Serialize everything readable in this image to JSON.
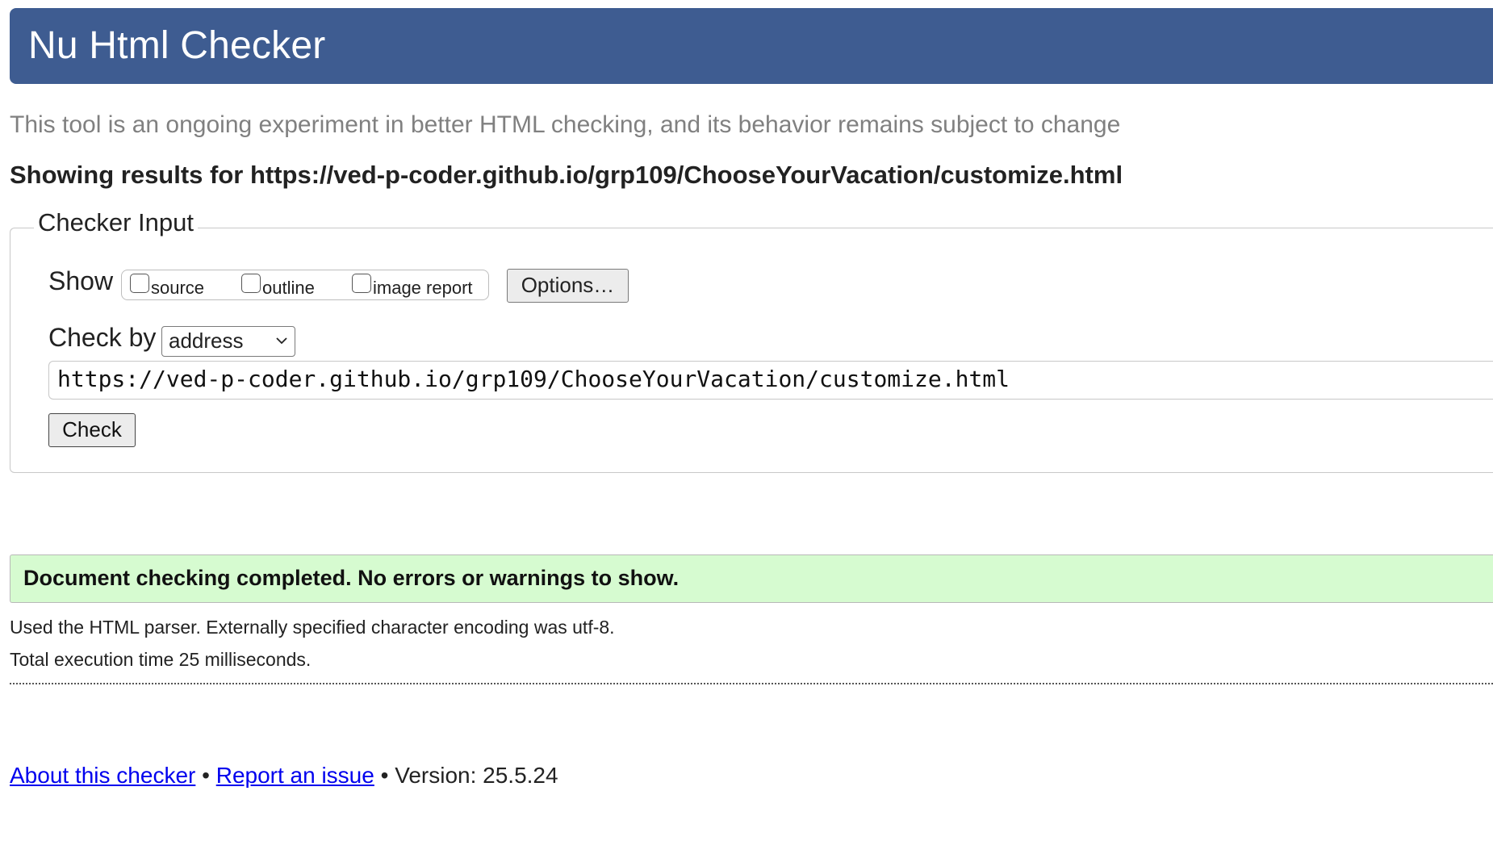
{
  "header": {
    "title": "Nu Html Checker",
    "background_color": "#3e5c91"
  },
  "subtitle": "This tool is an ongoing experiment in better HTML checking, and its behavior remains subject to change",
  "results_heading": "Showing results for https://ved-p-coder.github.io/grp109/ChooseYourVacation/customize.html",
  "checker_input": {
    "legend": "Checker Input",
    "show_label": "Show",
    "show_options": [
      {
        "label": "source",
        "checked": false
      },
      {
        "label": "outline",
        "checked": false
      },
      {
        "label": "image report",
        "checked": false
      }
    ],
    "options_button": "Options…",
    "check_by_label": "Check by",
    "check_by_selected": "address",
    "url_value": "https://ved-p-coder.github.io/grp109/ChooseYourVacation/customize.html",
    "check_button": "Check"
  },
  "result": {
    "message": "Document checking completed. No errors or warnings to show.",
    "background_color": "#d6fbd0"
  },
  "info": {
    "parser_line": "Used the HTML parser. Externally specified character encoding was utf-8.",
    "time_line": "Total execution time 25 milliseconds."
  },
  "footer": {
    "about_link": "About this checker",
    "separator": "•",
    "report_link": "Report an issue",
    "version_text": "Version: 25.5.24",
    "link_color": "#0000ee"
  }
}
